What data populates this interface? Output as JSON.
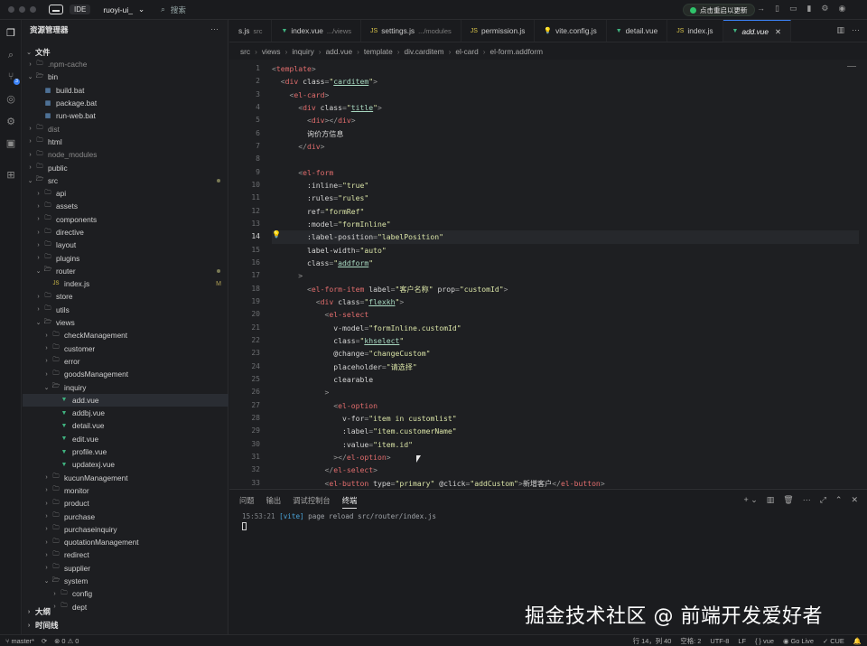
{
  "titlebar": {
    "ide_label": "IDE",
    "project": "ruoyi-ui_",
    "search_placeholder": "搜索",
    "restart_label": "点击重启以更新"
  },
  "sidebar": {
    "title": "资源管理器",
    "section_files": "文件",
    "tree": [
      {
        "label": ".npm-cache",
        "depth": 0,
        "kind": "folder",
        "open": false,
        "dim": true
      },
      {
        "label": "bin",
        "depth": 0,
        "kind": "folder",
        "open": true
      },
      {
        "label": "build.bat",
        "depth": 1,
        "kind": "bat"
      },
      {
        "label": "package.bat",
        "depth": 1,
        "kind": "bat"
      },
      {
        "label": "run-web.bat",
        "depth": 1,
        "kind": "bat"
      },
      {
        "label": "dist",
        "depth": 0,
        "kind": "folder",
        "open": false,
        "dim": true
      },
      {
        "label": "html",
        "depth": 0,
        "kind": "folder",
        "open": false
      },
      {
        "label": "node_modules",
        "depth": 0,
        "kind": "folder",
        "open": false,
        "dim": true
      },
      {
        "label": "public",
        "depth": 0,
        "kind": "folder",
        "open": false
      },
      {
        "label": "src",
        "depth": 0,
        "kind": "folder",
        "open": true,
        "dot": true
      },
      {
        "label": "api",
        "depth": 1,
        "kind": "folder",
        "open": false
      },
      {
        "label": "assets",
        "depth": 1,
        "kind": "folder",
        "open": false
      },
      {
        "label": "components",
        "depth": 1,
        "kind": "folder",
        "open": false
      },
      {
        "label": "directive",
        "depth": 1,
        "kind": "folder",
        "open": false
      },
      {
        "label": "layout",
        "depth": 1,
        "kind": "folder",
        "open": false
      },
      {
        "label": "plugins",
        "depth": 1,
        "kind": "folder",
        "open": false
      },
      {
        "label": "router",
        "depth": 1,
        "kind": "folder",
        "open": true,
        "dot": true
      },
      {
        "label": "index.js",
        "depth": 2,
        "kind": "js",
        "mark": "M"
      },
      {
        "label": "store",
        "depth": 1,
        "kind": "folder",
        "open": false
      },
      {
        "label": "utils",
        "depth": 1,
        "kind": "folder",
        "open": false
      },
      {
        "label": "views",
        "depth": 1,
        "kind": "folder",
        "open": true
      },
      {
        "label": "checkManagement",
        "depth": 2,
        "kind": "folder",
        "open": false
      },
      {
        "label": "customer",
        "depth": 2,
        "kind": "folder",
        "open": false
      },
      {
        "label": "error",
        "depth": 2,
        "kind": "folder",
        "open": false
      },
      {
        "label": "goodsManagement",
        "depth": 2,
        "kind": "folder",
        "open": false
      },
      {
        "label": "inquiry",
        "depth": 2,
        "kind": "folder",
        "open": true
      },
      {
        "label": "add.vue",
        "depth": 3,
        "kind": "vue",
        "selected": true
      },
      {
        "label": "addbj.vue",
        "depth": 3,
        "kind": "vue"
      },
      {
        "label": "detail.vue",
        "depth": 3,
        "kind": "vue"
      },
      {
        "label": "edit.vue",
        "depth": 3,
        "kind": "vue"
      },
      {
        "label": "profile.vue",
        "depth": 3,
        "kind": "vue"
      },
      {
        "label": "updatexj.vue",
        "depth": 3,
        "kind": "vue"
      },
      {
        "label": "kucunManagement",
        "depth": 2,
        "kind": "folder",
        "open": false
      },
      {
        "label": "monitor",
        "depth": 2,
        "kind": "folder",
        "open": false
      },
      {
        "label": "product",
        "depth": 2,
        "kind": "folder",
        "open": false
      },
      {
        "label": "purchase",
        "depth": 2,
        "kind": "folder",
        "open": false
      },
      {
        "label": "purchaseinquiry",
        "depth": 2,
        "kind": "folder",
        "open": false
      },
      {
        "label": "quotationManagement",
        "depth": 2,
        "kind": "folder",
        "open": false
      },
      {
        "label": "redirect",
        "depth": 2,
        "kind": "folder",
        "open": false
      },
      {
        "label": "supplier",
        "depth": 2,
        "kind": "folder",
        "open": false
      },
      {
        "label": "system",
        "depth": 2,
        "kind": "folder",
        "open": true
      },
      {
        "label": "config",
        "depth": 3,
        "kind": "folder",
        "open": false
      },
      {
        "label": "dept",
        "depth": 3,
        "kind": "folder",
        "open": false
      }
    ],
    "section_outline": "大纲",
    "section_timeline": "时间线"
  },
  "tabs": [
    {
      "label": "s.js",
      "sub": "src",
      "icon": "none"
    },
    {
      "label": "index.vue",
      "sub": ".../views",
      "icon": "vue"
    },
    {
      "label": "settings.js",
      "sub": ".../modules",
      "icon": "js"
    },
    {
      "label": "permission.js",
      "sub": "",
      "icon": "js"
    },
    {
      "label": "vite.config.js",
      "sub": "",
      "icon": "bulb"
    },
    {
      "label": "detail.vue",
      "sub": "",
      "icon": "vue"
    },
    {
      "label": "index.js",
      "sub": "",
      "icon": "js"
    },
    {
      "label": "add.vue",
      "sub": "",
      "icon": "vue",
      "active": true
    }
  ],
  "breadcrumb": [
    "src",
    "views",
    "inquiry",
    "add.vue",
    "template",
    "div.carditem",
    "el-card",
    "el-form.addform"
  ],
  "editor": {
    "current_line": 14,
    "lines": [
      {
        "n": 1,
        "html": "<span class='p'>&lt;</span><span class='t'>template</span><span class='p'>&gt;</span>"
      },
      {
        "n": 2,
        "html": "  <span class='p'>&lt;</span><span class='t'>div</span> <span class='a'>class</span><span class='p'>=</span><span class='s'>\"</span><span class='su'>carditem</span><span class='s'>\"</span><span class='p'>&gt;</span>"
      },
      {
        "n": 3,
        "html": "    <span class='p'>&lt;</span><span class='t'>el-card</span><span class='p'>&gt;</span>"
      },
      {
        "n": 4,
        "html": "      <span class='p'>&lt;</span><span class='t'>div</span> <span class='a'>class</span><span class='p'>=</span><span class='s'>\"</span><span class='su'>title</span><span class='s'>\"</span><span class='p'>&gt;</span>"
      },
      {
        "n": 5,
        "html": "        <span class='p'>&lt;</span><span class='t'>div</span><span class='p'>&gt;&lt;/</span><span class='t'>div</span><span class='p'>&gt;</span>"
      },
      {
        "n": 6,
        "html": "        询价方信息"
      },
      {
        "n": 7,
        "html": "      <span class='p'>&lt;/</span><span class='t'>div</span><span class='p'>&gt;</span>"
      },
      {
        "n": 8,
        "html": ""
      },
      {
        "n": 9,
        "html": "      <span class='p'>&lt;</span><span class='t'>el-form</span>"
      },
      {
        "n": 10,
        "html": "        <span class='a'>:inline</span><span class='p'>=</span><span class='s'>\"true\"</span>"
      },
      {
        "n": 11,
        "html": "        <span class='a'>:rules</span><span class='p'>=</span><span class='s'>\"rules\"</span>"
      },
      {
        "n": 12,
        "html": "        <span class='a'>ref</span><span class='p'>=</span><span class='s'>\"formRef\"</span>"
      },
      {
        "n": 13,
        "html": "        <span class='a'>:model</span><span class='p'>=</span><span class='s'>\"formInline\"</span>"
      },
      {
        "n": 14,
        "html": "        <span class='a'>:label-position</span><span class='p'>=</span><span class='s'>\"labelPosition\"</span>"
      },
      {
        "n": 15,
        "html": "        <span class='a'>label-width</span><span class='p'>=</span><span class='s'>\"auto\"</span>"
      },
      {
        "n": 16,
        "html": "        <span class='a'>class</span><span class='p'>=</span><span class='s'>\"</span><span class='su'>addform</span><span class='s'>\"</span>"
      },
      {
        "n": 17,
        "html": "      <span class='p'>&gt;</span>"
      },
      {
        "n": 18,
        "html": "        <span class='p'>&lt;</span><span class='t'>el-form-item</span> <span class='a'>label</span><span class='p'>=</span><span class='s'>\"客户名称\"</span> <span class='a'>prop</span><span class='p'>=</span><span class='s'>\"customId\"</span><span class='p'>&gt;</span>"
      },
      {
        "n": 19,
        "html": "          <span class='p'>&lt;</span><span class='t'>div</span> <span class='a'>class</span><span class='p'>=</span><span class='s'>\"</span><span class='su'>flexkh</span><span class='s'>\"</span><span class='p'>&gt;</span>"
      },
      {
        "n": 20,
        "html": "            <span class='p'>&lt;</span><span class='t'>el-select</span>"
      },
      {
        "n": 21,
        "html": "              <span class='a'>v-model</span><span class='p'>=</span><span class='s'>\"formInline.customId\"</span>"
      },
      {
        "n": 22,
        "html": "              <span class='a'>class</span><span class='p'>=</span><span class='s'>\"</span><span class='su'>khselect</span><span class='s'>\"</span>"
      },
      {
        "n": 23,
        "html": "              <span class='a'>@change</span><span class='p'>=</span><span class='s'>\"changeCustom\"</span>"
      },
      {
        "n": 24,
        "html": "              <span class='a'>placeholder</span><span class='p'>=</span><span class='s'>\"请选择\"</span>"
      },
      {
        "n": 25,
        "html": "              <span class='a'>clearable</span>"
      },
      {
        "n": 26,
        "html": "            <span class='p'>&gt;</span>"
      },
      {
        "n": 27,
        "html": "              <span class='p'>&lt;</span><span class='t'>el-option</span>"
      },
      {
        "n": 28,
        "html": "                <span class='a'>v-for</span><span class='p'>=</span><span class='s'>\"item in customlist\"</span>"
      },
      {
        "n": 29,
        "html": "                <span class='a'>:label</span><span class='p'>=</span><span class='s'>\"item.customerName\"</span>"
      },
      {
        "n": 30,
        "html": "                <span class='a'>:value</span><span class='p'>=</span><span class='s'>\"item.id\"</span>"
      },
      {
        "n": 31,
        "html": "              <span class='p'>&gt;&lt;/</span><span class='t'>el-option</span><span class='p'>&gt;</span>"
      },
      {
        "n": 32,
        "html": "            <span class='p'>&lt;/</span><span class='t'>el-select</span><span class='p'>&gt;</span>"
      },
      {
        "n": 33,
        "html": "            <span class='p'>&lt;</span><span class='t'>el-button</span> <span class='a'>type</span><span class='p'>=</span><span class='s'>\"primary\"</span> <span class='a'>@click</span><span class='p'>=</span><span class='s'>\"addCustom\"</span><span class='p'>&gt;</span>新增客户<span class='p'>&lt;/</span><span class='t'>el-button</span><span class='p'>&gt;</span>"
      }
    ]
  },
  "panel": {
    "tabs": [
      "问题",
      "输出",
      "调试控制台",
      "终端"
    ],
    "active_tab": "终端",
    "term_time": "15:53:21",
    "term_tag": "[vite]",
    "term_msg": "page reload src/router/index.js",
    "watermark": "掘金技术社区 @ 前端开发爱好者"
  },
  "statusbar": {
    "branch": "master*",
    "errors": "0",
    "warnings": "0",
    "position": "行 14，列 40",
    "spaces": "空格: 2",
    "encoding": "UTF-8",
    "eol": "LF",
    "language": "vue",
    "golive": "Go Live",
    "cue": "CUE"
  },
  "colors": {
    "accent": "#3b82f6",
    "vue": "#3fb27f",
    "js": "#d8c34a",
    "tag": "#e26d6d",
    "string": "#d9e3a6"
  }
}
